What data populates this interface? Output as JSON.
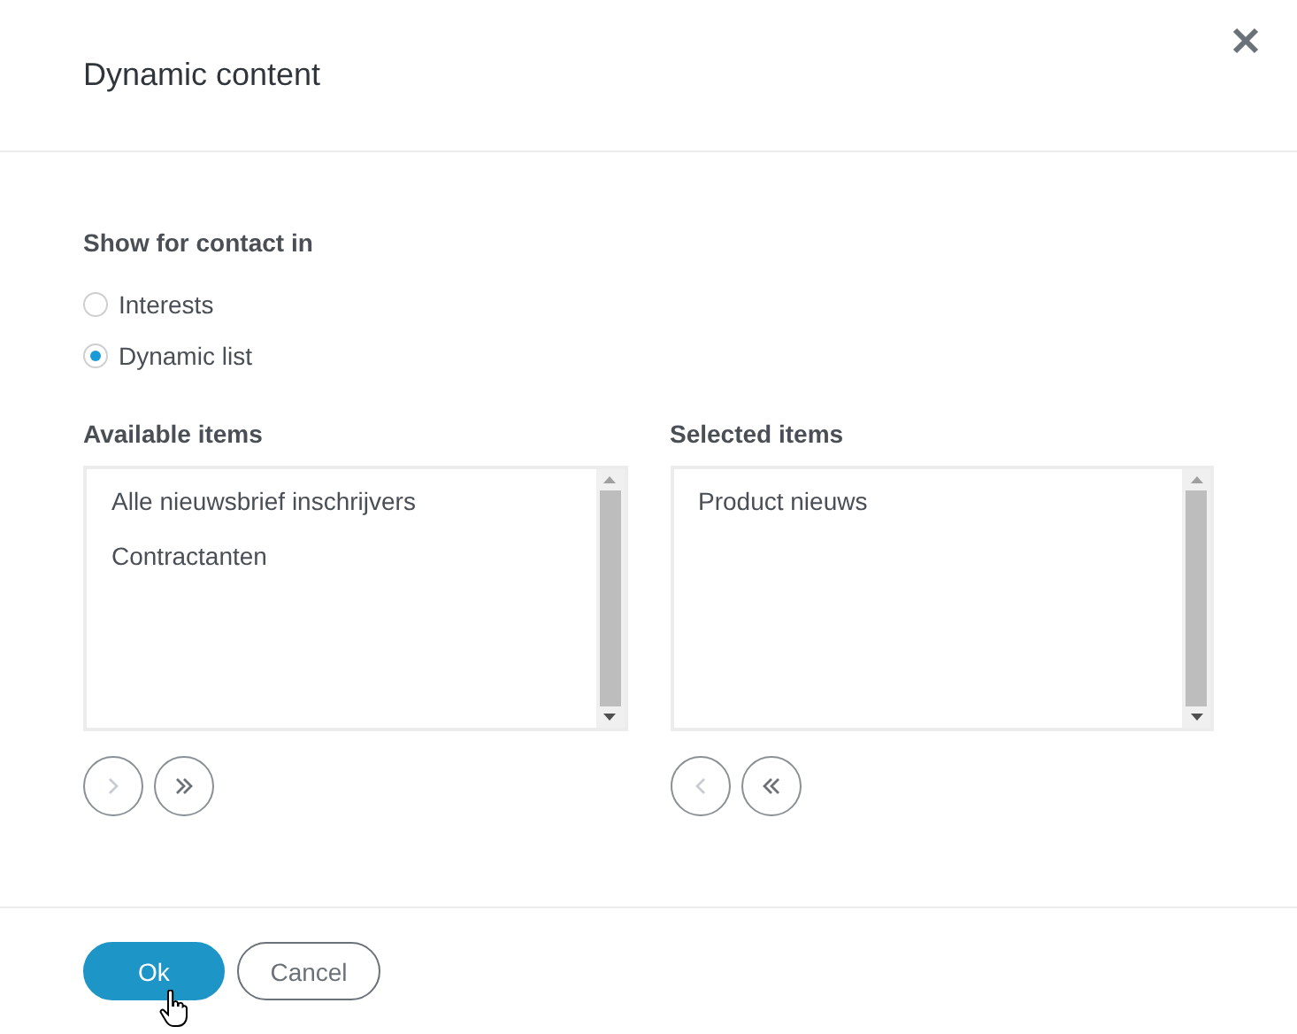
{
  "dialog": {
    "title": "Dynamic content"
  },
  "show_for": {
    "label": "Show for contact in",
    "options": [
      {
        "label": "Interests",
        "selected": false
      },
      {
        "label": "Dynamic list",
        "selected": true
      }
    ]
  },
  "lists": [
    {
      "label": "Available items",
      "items": [
        "Alle nieuwsbrief inschrijvers",
        "Contractanten"
      ],
      "moves": [
        {
          "kind": "single",
          "disabled": true
        },
        {
          "kind": "all",
          "disabled": false
        }
      ]
    },
    {
      "label": "Selected items",
      "items": [
        "Product nieuws"
      ],
      "moves": [
        {
          "kind": "single",
          "disabled": true
        },
        {
          "kind": "all",
          "disabled": false
        }
      ]
    }
  ],
  "buttons": [
    {
      "label": "Ok",
      "kind": "primary"
    },
    {
      "label": "Cancel",
      "kind": "secondary"
    }
  ]
}
